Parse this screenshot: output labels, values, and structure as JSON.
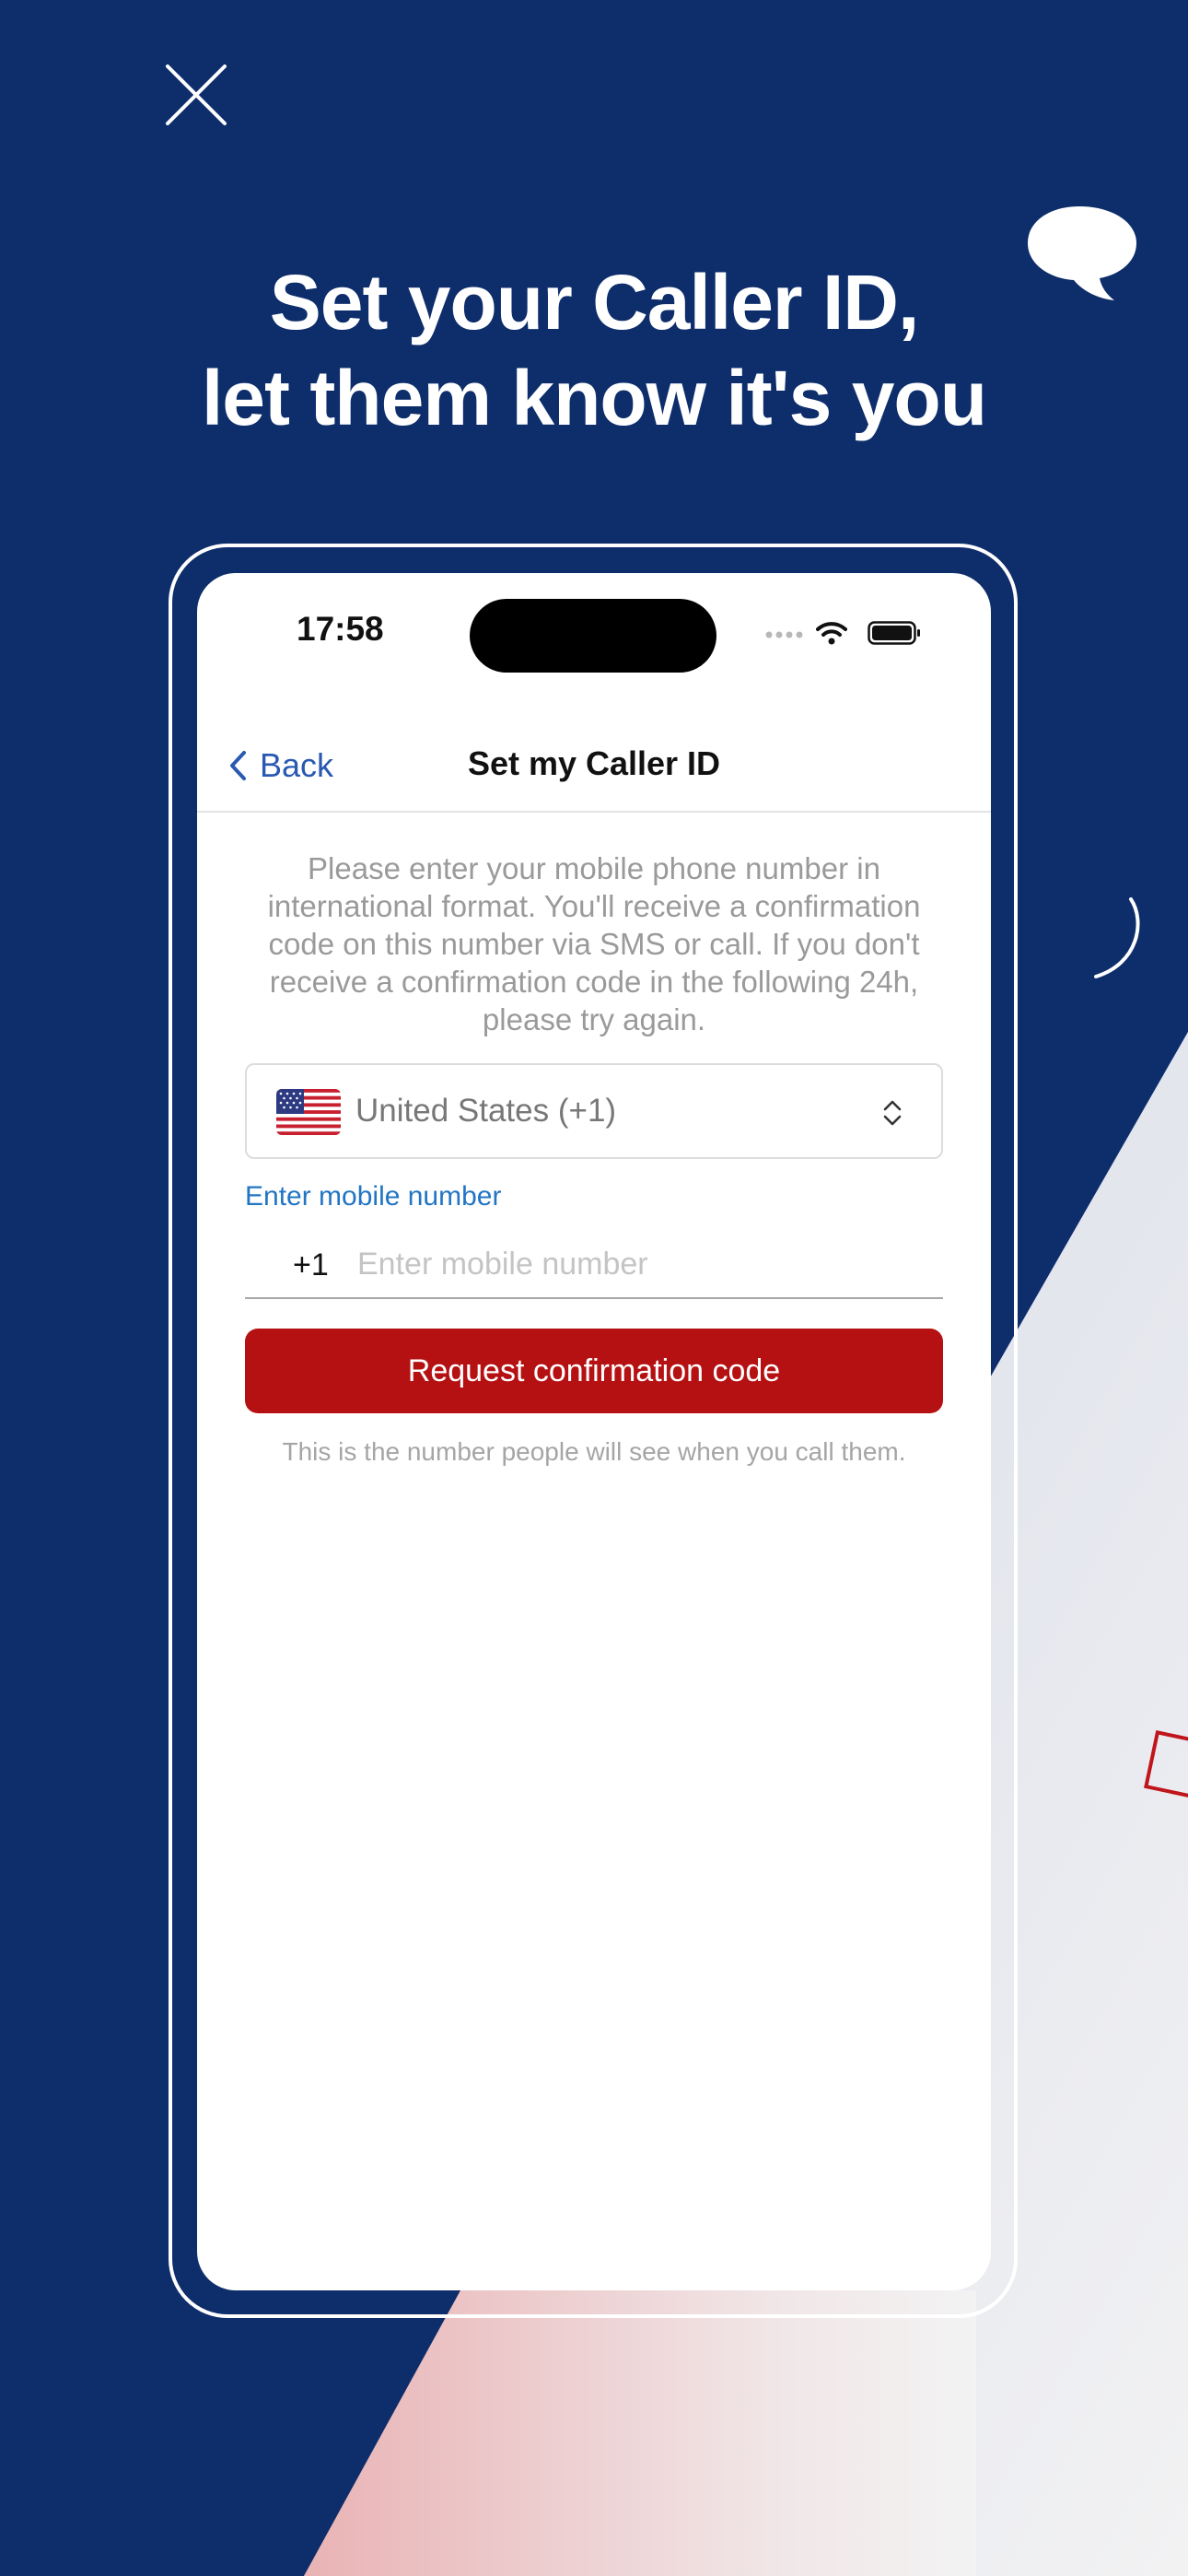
{
  "colors": {
    "background": "#0d2d6b",
    "accent_red": "#b51113",
    "link_blue": "#2a59b2",
    "label_blue": "#2275c4"
  },
  "icons": [
    "close-icon",
    "speech-bubble-icon",
    "back-chevron-icon",
    "wifi-icon",
    "battery-icon",
    "us-flag-icon",
    "chevron-updown-icon"
  ],
  "headline": {
    "line1": "Set your Caller ID,",
    "line2": "let them know it's you"
  },
  "status_bar": {
    "time": "17:58"
  },
  "nav": {
    "back_label": "Back",
    "title": "Set my Caller ID"
  },
  "form": {
    "instructions": "Please enter your mobile phone number in international format. You'll receive a confirmation code on this number via SMS or call. If you don't receive a confirmation code in the following 24h, please try again.",
    "country": "United States (+1)",
    "field_label": "Enter mobile number",
    "prefix": "+1",
    "phone_value": "",
    "phone_placeholder": "Enter mobile number",
    "submit_label": "Request confirmation code",
    "hint": "This is the number people will see when you call them."
  }
}
